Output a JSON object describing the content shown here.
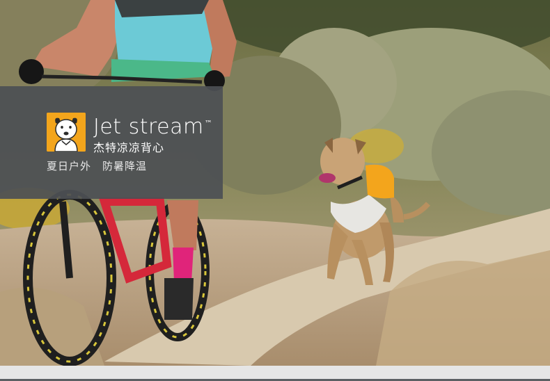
{
  "banner": {
    "product_name": "Jet stream",
    "trademark": "™",
    "chinese_name": "杰特凉凉背心",
    "tagline": "夏日户外　防暑降温"
  },
  "icons": {
    "logo": "dog-head-logo"
  },
  "colors": {
    "banner_bg": "#4c5054",
    "logo_bg": "#f3a51c",
    "vest_orange": "#f3a51c"
  }
}
